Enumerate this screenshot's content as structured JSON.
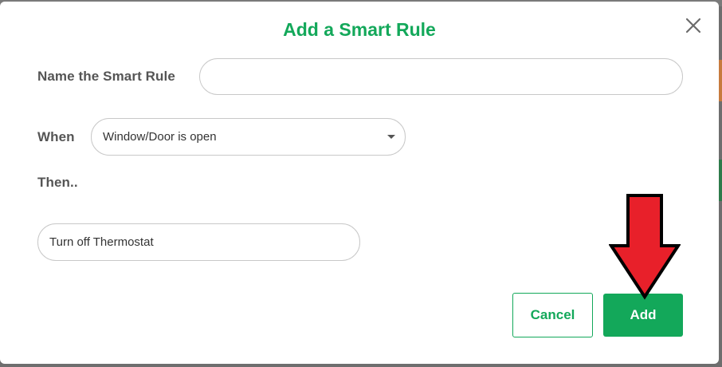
{
  "dialog": {
    "title": "Add a Smart Rule",
    "close_icon": "close-icon"
  },
  "form": {
    "name_label": "Name the Smart Rule",
    "name_value": "",
    "when_label": "When",
    "when_selected": "Window/Door is open",
    "then_label": "Then..",
    "then_value": "Turn off Thermostat"
  },
  "buttons": {
    "cancel_label": "Cancel",
    "add_label": "Add"
  },
  "colors": {
    "accent": "#13a85a",
    "label_text": "#555555",
    "annotation_arrow": "#e8202a"
  },
  "annotation": {
    "icon": "red-down-arrow-icon"
  }
}
